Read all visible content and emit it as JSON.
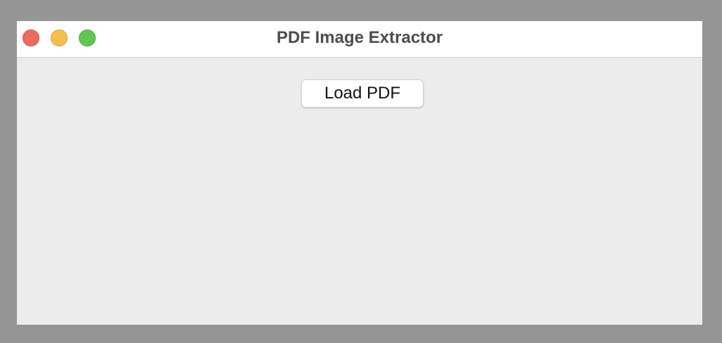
{
  "window": {
    "title": "PDF Image Extractor",
    "controls": [
      "close-icon",
      "minimize-icon",
      "maximize-icon"
    ]
  },
  "main": {
    "load_button_label": "Load PDF"
  },
  "colors": {
    "desktop_background": "#959595",
    "titlebar_background": "#ffffff",
    "content_background": "#ececec",
    "close": "#ed6a5e",
    "minimize": "#f5bf4f",
    "maximize": "#61c554"
  }
}
